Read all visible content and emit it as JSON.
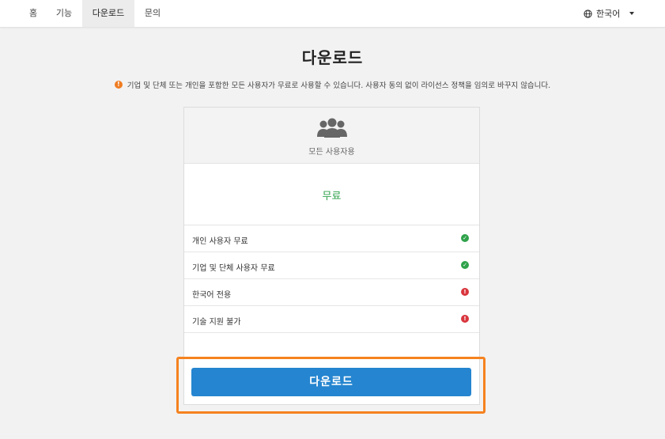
{
  "nav": {
    "items": [
      {
        "label": "홈",
        "active": false
      },
      {
        "label": "기능",
        "active": false
      },
      {
        "label": "다운로드",
        "active": true
      },
      {
        "label": "문의",
        "active": false
      }
    ],
    "language": "한국어",
    "language_icon": "globe-icon",
    "dropdown_icon": "caret-down-icon"
  },
  "page": {
    "title": "다운로드",
    "notice": "기업 및 단체 또는 개인을 포함한 모든 사용자가 무료로 사용할 수 있습니다. 사용자 동의 없이 라이선스 정책을 임의로 바꾸지 않습니다.",
    "notice_icon": "exclamation-circle-icon"
  },
  "card": {
    "icon": "users-icon",
    "header_label": "모든 사용자용",
    "price": "무료",
    "features": [
      {
        "label": "개인 사용자 무료",
        "status": "ok"
      },
      {
        "label": "기업 및 단체 사용자 무료",
        "status": "ok"
      },
      {
        "label": "한국어 전용",
        "status": "warn"
      },
      {
        "label": "기술 지원 불가",
        "status": "warn"
      }
    ],
    "download_label": "다운로드"
  },
  "colors": {
    "accent_blue": "#2585d0",
    "highlight_orange": "#f5821f",
    "ok_green": "#2fa24a",
    "warn_red": "#d9363e",
    "notice_orange": "#ef7c21"
  }
}
